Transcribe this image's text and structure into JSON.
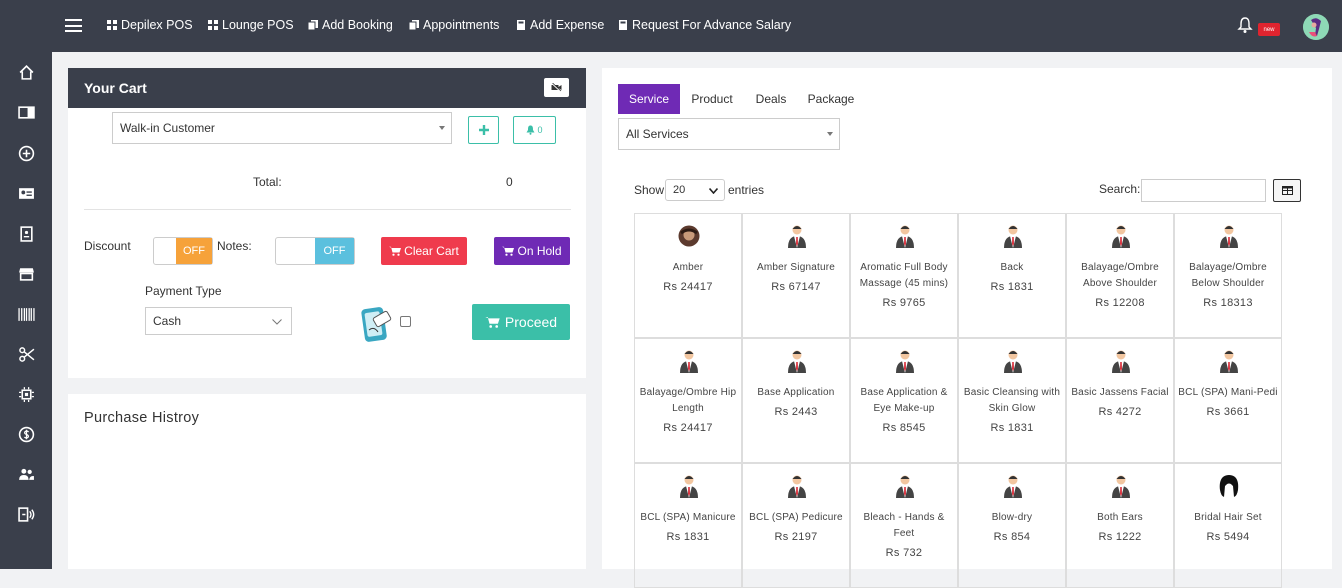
{
  "nav": {
    "items": [
      {
        "label": "Depilex POS",
        "icon": "grid-icon"
      },
      {
        "label": "Lounge POS",
        "icon": "grid-icon"
      },
      {
        "label": "Add Booking",
        "icon": "copy-icon"
      },
      {
        "label": "Appointments",
        "icon": "copy-icon"
      },
      {
        "label": "Add Expense",
        "icon": "calculator-icon"
      },
      {
        "label": "Request For Advance Salary",
        "icon": "calculator-icon"
      }
    ],
    "badge": "new"
  },
  "sidebar": {
    "icons": [
      "home-icon",
      "columns-icon",
      "plus-circle-icon",
      "id-card-icon",
      "clipboard-icon",
      "store-icon",
      "barcode-icon",
      "scissors-icon",
      "chip-icon",
      "dollar-icon",
      "users-icon",
      "dispatch-icon"
    ]
  },
  "cart": {
    "title": "Your Cart",
    "customer": "Walk-in Customer",
    "notify_count": "0",
    "total_label": "Total:",
    "total_value": "0",
    "discount_label": "Discount",
    "discount_state": "OFF",
    "notes_label": "Notes:",
    "notes_state": "OFF",
    "clear_label": "Clear Cart",
    "hold_label": "On Hold",
    "payment_type_label": "Payment Type",
    "payment_type": "Cash",
    "proceed_label": "Proceed"
  },
  "purchase": {
    "title": "Purchase Histroy"
  },
  "panel": {
    "tabs": [
      "Service",
      "Product",
      "Deals",
      "Package"
    ],
    "active_tab": "Service",
    "filter": "All Services",
    "show_label": "Show",
    "entries_value": "20",
    "entries_label": "entries",
    "search_label": "Search:",
    "search_value": ""
  },
  "services": [
    {
      "name": "Amber",
      "price": "Rs 24417",
      "img": "round"
    },
    {
      "name": "Amber Signature",
      "price": "Rs 67147",
      "img": "man"
    },
    {
      "name": "Aromatic Full Body Massage (45 mins)",
      "price": "Rs 9765",
      "img": "man"
    },
    {
      "name": "Back",
      "price": "Rs 1831",
      "img": "man"
    },
    {
      "name": "Balayage/Ombre Above Shoulder",
      "price": "Rs 12208",
      "img": "man"
    },
    {
      "name": "Balayage/Ombre Below Shoulder",
      "price": "Rs 18313",
      "img": "man"
    },
    {
      "name": "Balayage/Ombre Hip Length",
      "price": "Rs 24417",
      "img": "man"
    },
    {
      "name": "Base Application",
      "price": "Rs 2443",
      "img": "man"
    },
    {
      "name": "Base Application & Eye Make-up",
      "price": "Rs 8545",
      "img": "man"
    },
    {
      "name": "Basic Cleansing with Skin Glow",
      "price": "Rs 1831",
      "img": "man"
    },
    {
      "name": "Basic Jassens Facial",
      "price": "Rs 4272",
      "img": "man"
    },
    {
      "name": "BCL (SPA) Mani-Pedi",
      "price": "Rs 3661",
      "img": "man"
    },
    {
      "name": "BCL (SPA) Manicure",
      "price": "Rs 1831",
      "img": "man"
    },
    {
      "name": "BCL (SPA) Pedicure",
      "price": "Rs 2197",
      "img": "man"
    },
    {
      "name": "Bleach - Hands & Feet",
      "price": "Rs 732",
      "img": "man"
    },
    {
      "name": "Blow-dry",
      "price": "Rs 854",
      "img": "man"
    },
    {
      "name": "Both Ears",
      "price": "Rs 1222",
      "img": "man"
    },
    {
      "name": "Bridal Hair Set",
      "price": "Rs 5494",
      "img": "hair"
    }
  ],
  "colors": {
    "topbar": "#3a3f4b",
    "accent_purple": "#6f2ab5",
    "teal": "#3bbfa8",
    "clear_red": "#ef3b4d",
    "discount_orange": "#f6a23a",
    "notes_blue": "#5bc0de",
    "badge_red": "#e0242f"
  }
}
